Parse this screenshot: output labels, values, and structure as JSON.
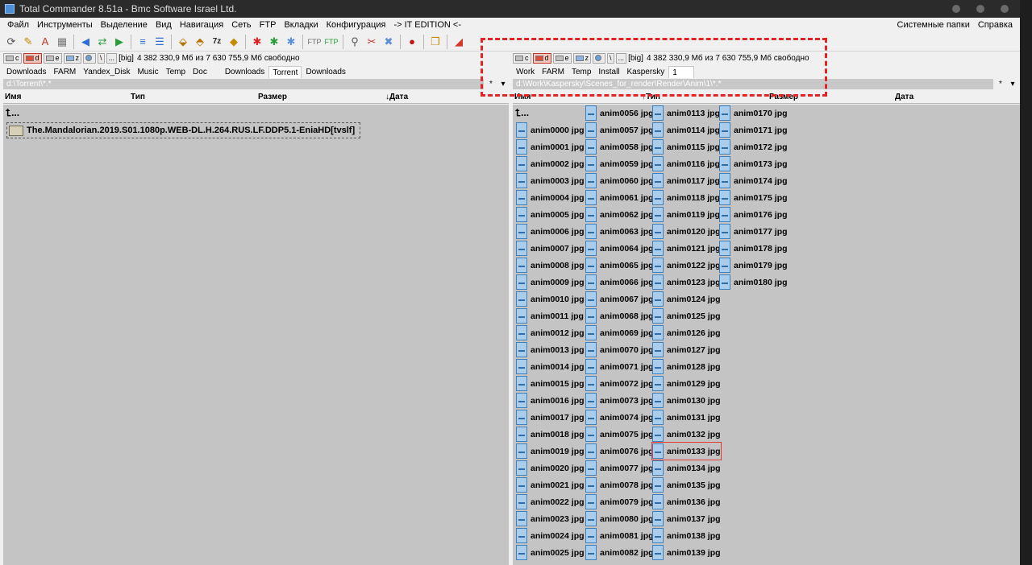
{
  "window": {
    "title": "Total Commander 8.51a - Bmc Software Israel Ltd."
  },
  "menu": {
    "items": [
      "Файл",
      "Инструменты",
      "Выделение",
      "Вид",
      "Навигация",
      "Сеть",
      "FTP",
      "Вкладки",
      "Конфигурация",
      "-> IT EDITION <-"
    ],
    "right": [
      "Системные папки",
      "Справка"
    ]
  },
  "toolbar": {
    "icons": [
      "refresh-icon",
      "edit-icon",
      "sort-icon",
      "view-icon",
      "back-icon",
      "swap-icon",
      "forward-icon",
      "compare-icon",
      "sync-icon",
      "pack-icon",
      "unpack-icon",
      "7zip-icon",
      "archive-icon",
      "multi-rename-icon",
      "unselect-icon",
      "settings-icon",
      "ftp-connect-icon",
      "ftp-new-icon",
      "search-icon",
      "cleanup-icon",
      "remove-icon",
      "record-icon",
      "copy-names-icon",
      "brush-icon"
    ]
  },
  "left": {
    "drives": [
      "c",
      "d",
      "e",
      "z",
      "\\",
      "..."
    ],
    "active_drive": "d",
    "volume": "[big]",
    "free": "4 382 330,9 Мб из 7 630 755,9 Мб свободно",
    "tabs": [
      "Downloads",
      "FARM",
      "Yandex_Disk",
      "Music",
      "Temp",
      "Doc",
      "Downloads",
      "Torrent",
      "Downloads"
    ],
    "active_tab": 7,
    "path": "d:\\Torrent\\*.*",
    "path_btn_history": "*",
    "path_btn_dropdown": "▾",
    "columns": {
      "name": "Имя",
      "type": "Тип",
      "size": "Размер",
      "date": "↓Дата"
    },
    "updir": "⮤...",
    "folder": "The.Mandalorian.2019.S01.1080p.WEB-DL.H.264.RUS.LF.DDP5.1-EniaHD[tvslf]"
  },
  "right": {
    "drives": [
      "c",
      "d",
      "e",
      "z",
      "\\",
      "..."
    ],
    "active_drive": "d",
    "volume": "[big]",
    "free": "4 382 330,9 Мб из 7 630 755,9 Мб свободно",
    "tabs": [
      "Work",
      "FARM",
      "Temp",
      "Install",
      "Kaspersky",
      "1"
    ],
    "active_tab": 5,
    "path": "d:\\Work\\Kaspersky\\Scenes_for_render\\Render\\Anim\\1\\*.*",
    "path_btn_history": "*",
    "path_btn_dropdown": "▾",
    "columns": {
      "name": "Имя",
      "type": "↑Тип",
      "size": "Размер",
      "date": "Дата"
    },
    "updir": "⮤...",
    "col1": [
      "anim0000 jpg",
      "anim0001 jpg",
      "anim0002 jpg",
      "anim0003 jpg",
      "anim0004 jpg",
      "anim0005 jpg",
      "anim0006 jpg",
      "anim0007 jpg",
      "anim0008 jpg",
      "anim0009 jpg",
      "anim0010 jpg",
      "anim0011 jpg",
      "anim0012 jpg",
      "anim0013 jpg",
      "anim0014 jpg",
      "anim0015 jpg",
      "anim0016 jpg",
      "anim0017 jpg",
      "anim0018 jpg",
      "anim0019 jpg",
      "anim0020 jpg",
      "anim0021 jpg",
      "anim0022 jpg",
      "anim0023 jpg",
      "anim0024 jpg",
      "anim0025 jpg"
    ],
    "col2": [
      "anim0056 jpg",
      "anim0057 jpg",
      "anim0058 jpg",
      "anim0059 jpg",
      "anim0060 jpg",
      "anim0061 jpg",
      "anim0062 jpg",
      "anim0063 jpg",
      "anim0064 jpg",
      "anim0065 jpg",
      "anim0066 jpg",
      "anim0067 jpg",
      "anim0068 jpg",
      "anim0069 jpg",
      "anim0070 jpg",
      "anim0071 jpg",
      "anim0072 jpg",
      "anim0073 jpg",
      "anim0074 jpg",
      "anim0075 jpg",
      "anim0076 jpg",
      "anim0077 jpg",
      "anim0078 jpg",
      "anim0079 jpg",
      "anim0080 jpg",
      "anim0081 jpg",
      "anim0082 jpg"
    ],
    "col3": [
      "anim0113 jpg",
      "anim0114 jpg",
      "anim0115 jpg",
      "anim0116 jpg",
      "anim0117 jpg",
      "anim0118 jpg",
      "anim0119 jpg",
      "anim0120 jpg",
      "anim0121 jpg",
      "anim0122 jpg",
      "anim0123 jpg",
      "anim0124 jpg",
      "anim0125 jpg",
      "anim0126 jpg",
      "anim0127 jpg",
      "anim0128 jpg",
      "anim0129 jpg",
      "anim0130 jpg",
      "anim0131 jpg",
      "anim0132 jpg",
      "anim0133 jpg",
      "anim0134 jpg",
      "anim0135 jpg",
      "anim0136 jpg",
      "anim0137 jpg",
      "anim0138 jpg",
      "anim0139 jpg"
    ],
    "col4": [
      "anim0170 jpg",
      "anim0171 jpg",
      "anim0172 jpg",
      "anim0173 jpg",
      "anim0174 jpg",
      "anim0175 jpg",
      "anim0176 jpg",
      "anim0177 jpg",
      "anim0178 jpg",
      "anim0179 jpg",
      "anim0180 jpg"
    ],
    "selected": "anim0133 jpg"
  }
}
